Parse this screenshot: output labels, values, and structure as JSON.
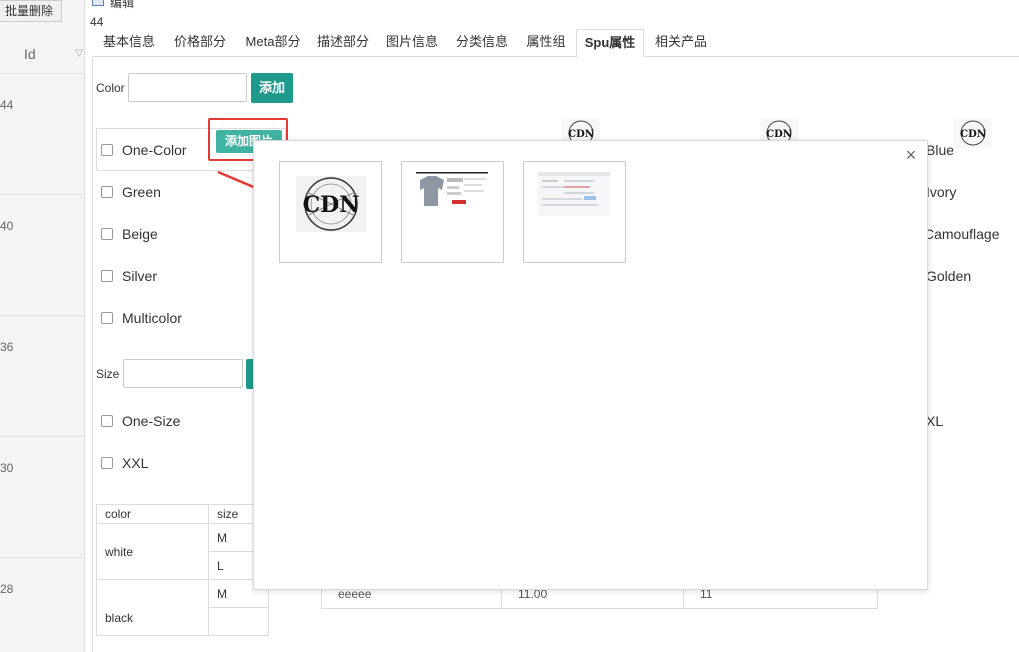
{
  "left_list": {
    "batch_delete_label": "批量删除",
    "id_header": "Id",
    "rows": [
      "44",
      "40",
      "36",
      "30",
      "28"
    ]
  },
  "window": {
    "title": "编辑",
    "record_id": "44"
  },
  "tabs": [
    {
      "label": "基本信息",
      "active": false
    },
    {
      "label": "价格部分",
      "active": false
    },
    {
      "label": "Meta部分",
      "active": false
    },
    {
      "label": "描述部分",
      "active": false
    },
    {
      "label": "图片信息",
      "active": false
    },
    {
      "label": "分类信息",
      "active": false
    },
    {
      "label": "属性组",
      "active": false
    },
    {
      "label": "Spu属性",
      "active": true
    },
    {
      "label": "相关产品",
      "active": false
    }
  ],
  "color_section": {
    "label": "Color",
    "input_value": "",
    "add_label": "添加",
    "add_image_label": "添加图片",
    "options_left": [
      "One-Color",
      "Green",
      "Beige",
      "Silver",
      "Multicolor"
    ],
    "options_right": [
      "Blue",
      "Ivory",
      "Camouflage",
      "Golden"
    ],
    "logo_text": "CDN"
  },
  "size_section": {
    "label": "Size",
    "input_value": "",
    "options_left": [
      "One-Size",
      "XXL"
    ],
    "options_right": [
      "XL"
    ]
  },
  "sku_table": {
    "headers": [
      "color",
      "size"
    ],
    "rows": [
      {
        "color": "white",
        "sizes": [
          "M",
          "L"
        ]
      },
      {
        "color": "black",
        "sizes": [
          "M"
        ]
      }
    ],
    "visible_row_values": [
      "eeeee",
      "11.00",
      "11"
    ]
  },
  "modal": {
    "close_symbol": "×",
    "images": [
      "cdn-logo-image",
      "sweatshirt-product-image",
      "webpage-screenshot-image"
    ],
    "logo_text": "CDN"
  },
  "colors": {
    "accent": "#1e9a8c",
    "highlight_frame": "#e53935",
    "arrow": "#e53935"
  }
}
